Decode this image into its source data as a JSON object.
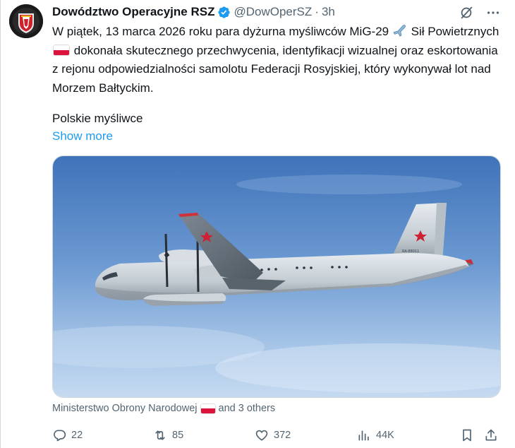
{
  "author": {
    "display_name": "Dowództwo Operacyjne RSZ",
    "handle": "@DowOperSZ",
    "separator": "·",
    "time": "3h",
    "verified": true
  },
  "tweet": {
    "text_part1": "W piątek, 13 marca 2026 roku para dyżurna myśliwców MiG-29",
    "text_part2": "Sił Powietrznych",
    "text_part3": "dokonała skutecznego przechwycenia, identyfikacji wizualnej oraz eskortowania z rejonu odpowiedzialności samolotu Federacji Rosyjskiej, który wykonywał lot nad Morzem Bałtyckim.",
    "paragraph2": "Polskie myśliwce",
    "show_more": "Show more"
  },
  "media": {
    "tail_text": "RA-88011"
  },
  "tagged": {
    "text_prefix": "Ministerstwo Obrony Narodowej",
    "text_suffix": "and 3 others"
  },
  "actions": {
    "replies": "22",
    "reposts": "85",
    "likes": "372",
    "views": "44K"
  },
  "colors": {
    "accent": "#1d9bf0",
    "secondary_text": "#536471",
    "verified": "#1d9bf0",
    "flag_red": "#dc143c"
  },
  "icons": [
    "grok-icon",
    "more-icon",
    "verified-icon",
    "plane-emoji",
    "poland-flag-icon",
    "reply-icon",
    "retweet-icon",
    "like-icon",
    "views-icon",
    "bookmark-icon",
    "share-icon"
  ]
}
